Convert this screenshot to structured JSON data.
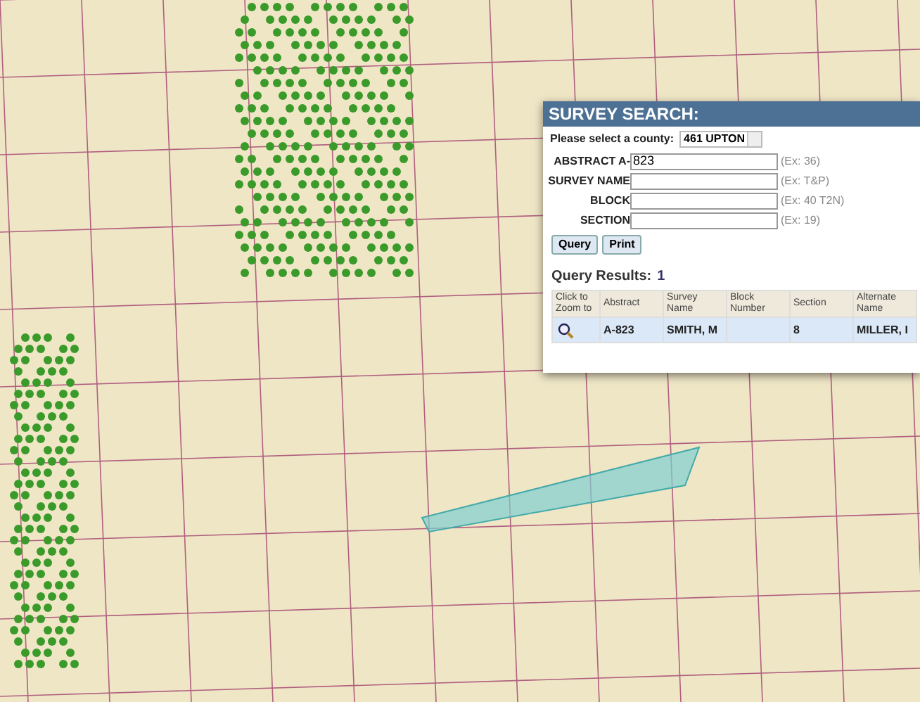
{
  "panel": {
    "title": "SURVEY SEARCH:",
    "county": {
      "label": "Please select a county:",
      "value": "461 UPTON"
    },
    "fields": [
      {
        "label": "ABSTRACT A-",
        "value": "823",
        "hint": "(Ex: 36)"
      },
      {
        "label": "SURVEY NAME",
        "hint": "(Ex: T&P)"
      },
      {
        "label": "BLOCK",
        "hint": "(Ex: 40 T2N)"
      },
      {
        "label": "SECTION",
        "hint": "(Ex: 19)"
      }
    ],
    "buttons": [
      "Query",
      "Print"
    ],
    "results": {
      "label": "Query Results:",
      "count": "1",
      "columns": [
        "Click to Zoom to",
        "Abstract",
        "Survey Name",
        "Block Number",
        "Section",
        "Alternate Name"
      ],
      "rows": [
        {
          "selected": true,
          "cells": [
            "",
            "A-823",
            "SMITH, M",
            "",
            "8",
            "MILLER, I"
          ]
        }
      ]
    }
  }
}
